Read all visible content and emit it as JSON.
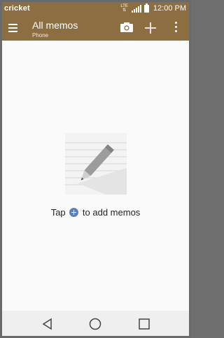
{
  "status_bar": {
    "carrier": "cricket",
    "network": "LTE",
    "time": "12:00 PM"
  },
  "app_bar": {
    "title": "All memos",
    "subtitle": "Phone"
  },
  "empty_state": {
    "tap_label": "Tap",
    "to_add_label": "to add memos"
  },
  "colors": {
    "app_bar": "#8c6e40",
    "plus_badge": "#5a80b7",
    "screen": "#fafafa",
    "nav_bar": "#efefef"
  }
}
